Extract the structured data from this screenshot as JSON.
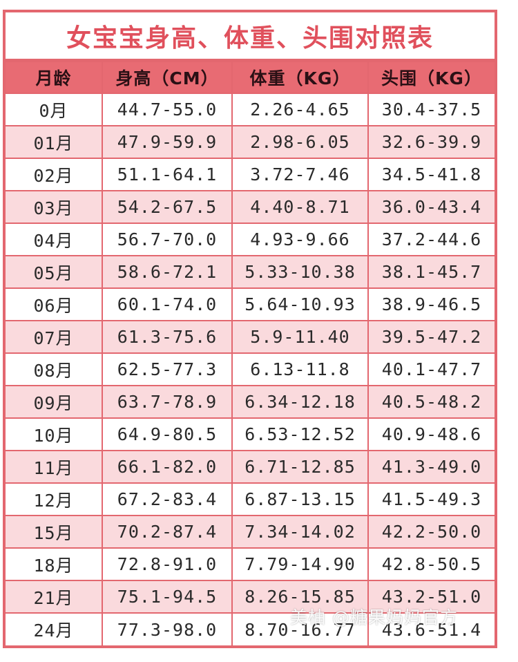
{
  "title": "女宝宝身高、体重、头围对照表",
  "headers": [
    "月龄",
    "身高（CM）",
    "体重（KG）",
    "头围（KG）"
  ],
  "rows": [
    [
      "0月",
      "44.7-55.0",
      "2.26-4.65",
      "30.4-37.5"
    ],
    [
      "01月",
      "47.9-59.9",
      "2.98-6.05",
      "32.6-39.9"
    ],
    [
      "02月",
      "51.1-64.1",
      "3.72-7.46",
      "34.5-41.8"
    ],
    [
      "03月",
      "54.2-67.5",
      "4.40-8.71",
      "36.0-43.4"
    ],
    [
      "04月",
      "56.7-70.0",
      "4.93-9.66",
      "37.2-44.6"
    ],
    [
      "05月",
      "58.6-72.1",
      "5.33-10.38",
      "38.1-45.7"
    ],
    [
      "06月",
      "60.1-74.0",
      "5.64-10.93",
      "38.9-46.5"
    ],
    [
      "07月",
      "61.3-75.6",
      "5.9-11.40",
      "39.5-47.2"
    ],
    [
      "08月",
      "62.5-77.3",
      "6.13-11.8",
      "40.1-47.7"
    ],
    [
      "09月",
      "63.7-78.9",
      "6.34-12.18",
      "40.5-48.2"
    ],
    [
      "10月",
      "64.9-80.5",
      "6.53-12.52",
      "40.9-48.6"
    ],
    [
      "11月",
      "66.1-82.0",
      "6.71-12.85",
      "41.3-49.0"
    ],
    [
      "12月",
      "67.2-83.4",
      "6.87-13.15",
      "41.5-49.3"
    ],
    [
      "15月",
      "70.2-87.4",
      "7.34-14.02",
      "42.2-50.0"
    ],
    [
      "18月",
      "72.8-91.0",
      "7.79-14.90",
      "42.8-50.5"
    ],
    [
      "21月",
      "75.1-94.5",
      "8.26-15.85",
      "43.2-51.0"
    ],
    [
      "24月",
      "77.3-98.0",
      "8.70-16.77",
      "43.6-51.4"
    ]
  ],
  "watermark": "美柚 @糖果妈妈官方",
  "colors": {
    "border": "#e3676f",
    "header_bg": "#e86b73",
    "title_text": "#e0505c",
    "stripe": "#fadadd"
  }
}
